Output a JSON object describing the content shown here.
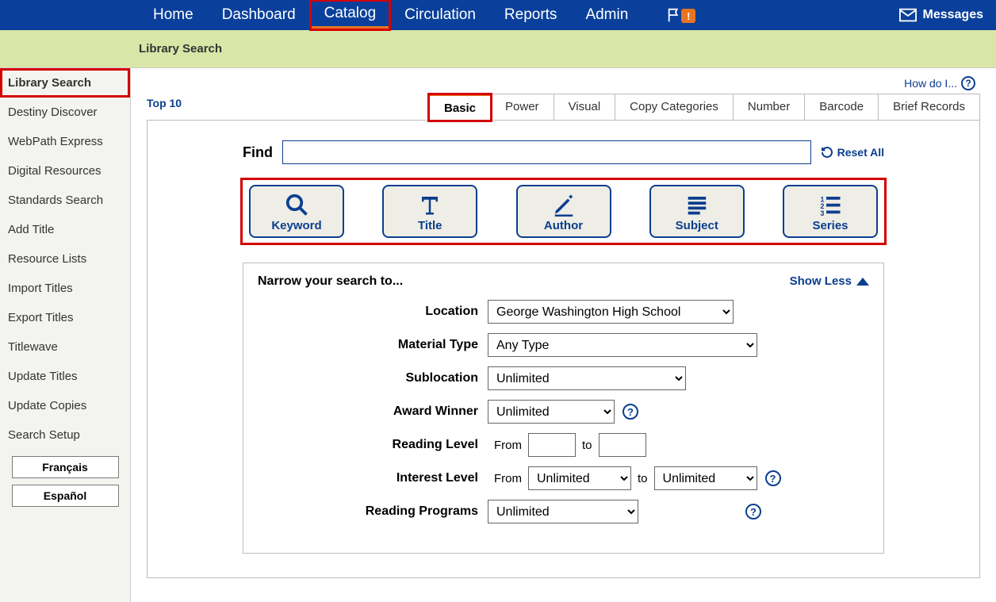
{
  "top_nav": {
    "items": [
      "Home",
      "Dashboard",
      "Catalog",
      "Circulation",
      "Reports",
      "Admin"
    ],
    "active_index": 2,
    "alert_badge": "!",
    "messages_label": "Messages"
  },
  "subheader": {
    "title": "Library Search"
  },
  "sidebar": {
    "items": [
      "Library Search",
      "Destiny Discover",
      "WebPath Express",
      "Digital Resources",
      "Standards Search",
      "Add Title",
      "Resource Lists",
      "Import Titles",
      "Export Titles",
      "Titlewave",
      "Update Titles",
      "Update Copies",
      "Search Setup"
    ],
    "active_index": 0,
    "lang_buttons": [
      "Français",
      "Español"
    ]
  },
  "main": {
    "how_do_i": "How do I...",
    "top10": "Top 10",
    "tabs": [
      "Basic",
      "Power",
      "Visual",
      "Copy Categories",
      "Number",
      "Barcode",
      "Brief Records"
    ],
    "active_tab_index": 0,
    "find_label": "Find",
    "find_value": "",
    "reset_label": "Reset All",
    "search_buttons": [
      {
        "label": "Keyword",
        "icon": "search-icon"
      },
      {
        "label": "Title",
        "icon": "title-icon"
      },
      {
        "label": "Author",
        "icon": "author-icon"
      },
      {
        "label": "Subject",
        "icon": "subject-icon"
      },
      {
        "label": "Series",
        "icon": "series-icon"
      }
    ],
    "narrow": {
      "heading": "Narrow your search to...",
      "show_less": "Show Less",
      "fields": {
        "location_label": "Location",
        "location_value": "George Washington High School",
        "material_label": "Material Type",
        "material_value": "Any Type",
        "sublocation_label": "Sublocation",
        "sublocation_value": "Unlimited",
        "award_label": "Award Winner",
        "award_value": "Unlimited",
        "reading_level_label": "Reading Level",
        "from_word": "From",
        "to_word": "to",
        "reading_from": "",
        "reading_to": "",
        "interest_label": "Interest Level",
        "interest_from_value": "Unlimited",
        "interest_to_value": "Unlimited",
        "programs_label": "Reading Programs",
        "programs_value": "Unlimited"
      }
    }
  }
}
